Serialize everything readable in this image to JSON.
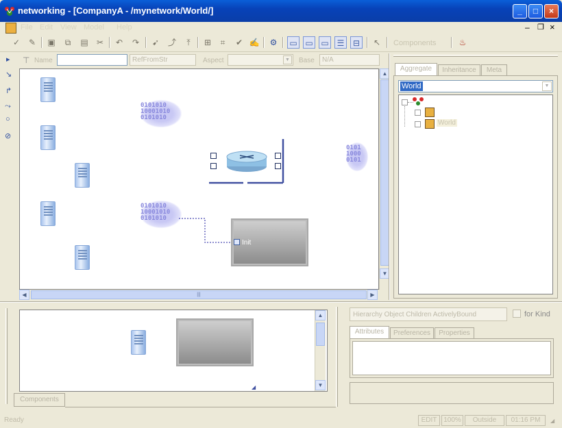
{
  "window": {
    "title": "networking - [CompanyA - /mynetwork/World/]",
    "controls": {
      "minimize": "_",
      "maximize": "□",
      "close": "×"
    }
  },
  "menu": {
    "items": [
      "File",
      "Edit",
      "View",
      "Model",
      "Help"
    ]
  },
  "toolbar": {
    "components_label": "Components"
  },
  "propbar": {
    "name_label": "Name",
    "name_value": "",
    "kind_value": "RefFromStr",
    "aspect_label": "Aspect",
    "aspect_value": "",
    "base_label": "Base",
    "base_value": "N/A"
  },
  "canvas": {
    "cloud_text": "0101010\n10001010\n0101010",
    "cloud_text_right": "0101\n1000\n0101",
    "port_label": "Init",
    "scroll_mid": "|||"
  },
  "browser": {
    "tabs": [
      "Aggregate",
      "Inheritance",
      "Meta"
    ],
    "active_tab": "Aggregate",
    "combo_value": "World",
    "tree": [
      {
        "label": "",
        "icon": "root-model-icon"
      },
      {
        "label": "",
        "icon": "model-icon"
      },
      {
        "label": "World",
        "icon": "model-icon"
      }
    ]
  },
  "bottom_panel": {
    "tab_label": "Components"
  },
  "attributes_panel": {
    "combo_text": "Hierarchy Object Children ActivelyBound",
    "checkbox_label": "for Kind",
    "tabs": [
      "Attributes",
      "Preferences",
      "Properties"
    ]
  },
  "status": {
    "text": "Ready",
    "boxes": [
      "EDIT",
      "100%",
      "Outside"
    ],
    "time": "01:16 PM"
  },
  "colors": {
    "title_blue": "#0a5fd8",
    "selection_blue": "#316ac5",
    "link_blue": "#4050a0"
  }
}
